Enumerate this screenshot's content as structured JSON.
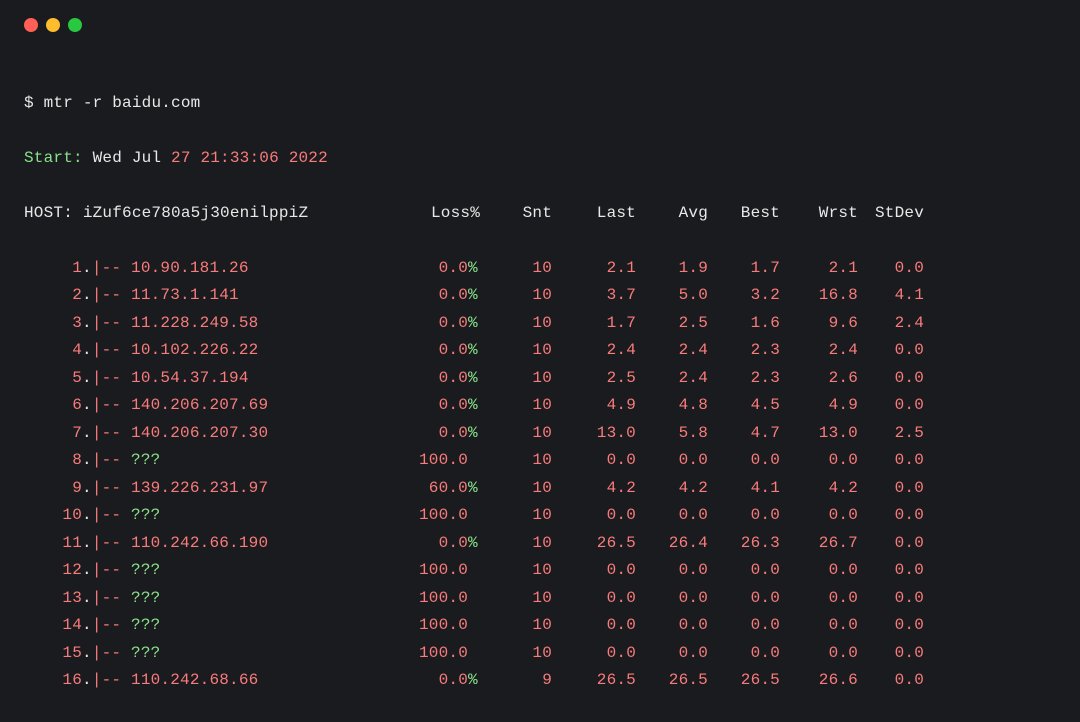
{
  "prompt": "$ ",
  "command": {
    "bin": "mtr",
    "flag": " -r ",
    "target": "baidu.com"
  },
  "start": {
    "label": "Start:",
    "day": " Wed Jul ",
    "date_num": "27",
    "time_sep": " ",
    "time": "21:33:06",
    "year_sep": " ",
    "year": "2022"
  },
  "header": {
    "host_label": "HOST: ",
    "host_value": "iZuf6ce780a5j30enilppiZ",
    "loss": "Loss%",
    "snt": "Snt",
    "last": "Last",
    "avg": "Avg",
    "best": "Best",
    "wrst": "Wrst",
    "stdev": "StDev"
  },
  "hops": [
    {
      "idx": "1",
      "ip": "10.90.181.26",
      "unknown": false,
      "loss": "0.0",
      "pct": "%",
      "snt": "10",
      "last": "2.1",
      "avg": "1.9",
      "best": "1.7",
      "wrst": "2.1",
      "stdev": "0.0"
    },
    {
      "idx": "2",
      "ip": "11.73.1.141",
      "unknown": false,
      "loss": "0.0",
      "pct": "%",
      "snt": "10",
      "last": "3.7",
      "avg": "5.0",
      "best": "3.2",
      "wrst": "16.8",
      "stdev": "4.1"
    },
    {
      "idx": "3",
      "ip": "11.228.249.58",
      "unknown": false,
      "loss": "0.0",
      "pct": "%",
      "snt": "10",
      "last": "1.7",
      "avg": "2.5",
      "best": "1.6",
      "wrst": "9.6",
      "stdev": "2.4"
    },
    {
      "idx": "4",
      "ip": "10.102.226.22",
      "unknown": false,
      "loss": "0.0",
      "pct": "%",
      "snt": "10",
      "last": "2.4",
      "avg": "2.4",
      "best": "2.3",
      "wrst": "2.4",
      "stdev": "0.0"
    },
    {
      "idx": "5",
      "ip": "10.54.37.194",
      "unknown": false,
      "loss": "0.0",
      "pct": "%",
      "snt": "10",
      "last": "2.5",
      "avg": "2.4",
      "best": "2.3",
      "wrst": "2.6",
      "stdev": "0.0"
    },
    {
      "idx": "6",
      "ip": "140.206.207.69",
      "unknown": false,
      "loss": "0.0",
      "pct": "%",
      "snt": "10",
      "last": "4.9",
      "avg": "4.8",
      "best": "4.5",
      "wrst": "4.9",
      "stdev": "0.0"
    },
    {
      "idx": "7",
      "ip": "140.206.207.30",
      "unknown": false,
      "loss": "0.0",
      "pct": "%",
      "snt": "10",
      "last": "13.0",
      "avg": "5.8",
      "best": "4.7",
      "wrst": "13.0",
      "stdev": "2.5"
    },
    {
      "idx": "8",
      "ip": "???",
      "unknown": true,
      "loss": "100.0",
      "pct": "",
      "snt": "10",
      "last": "0.0",
      "avg": "0.0",
      "best": "0.0",
      "wrst": "0.0",
      "stdev": "0.0"
    },
    {
      "idx": "9",
      "ip": "139.226.231.97",
      "unknown": false,
      "loss": "60.0",
      "pct": "%",
      "snt": "10",
      "last": "4.2",
      "avg": "4.2",
      "best": "4.1",
      "wrst": "4.2",
      "stdev": "0.0"
    },
    {
      "idx": "10",
      "ip": "???",
      "unknown": true,
      "loss": "100.0",
      "pct": "",
      "snt": "10",
      "last": "0.0",
      "avg": "0.0",
      "best": "0.0",
      "wrst": "0.0",
      "stdev": "0.0"
    },
    {
      "idx": "11",
      "ip": "110.242.66.190",
      "unknown": false,
      "loss": "0.0",
      "pct": "%",
      "snt": "10",
      "last": "26.5",
      "avg": "26.4",
      "best": "26.3",
      "wrst": "26.7",
      "stdev": "0.0"
    },
    {
      "idx": "12",
      "ip": "???",
      "unknown": true,
      "loss": "100.0",
      "pct": "",
      "snt": "10",
      "last": "0.0",
      "avg": "0.0",
      "best": "0.0",
      "wrst": "0.0",
      "stdev": "0.0"
    },
    {
      "idx": "13",
      "ip": "???",
      "unknown": true,
      "loss": "100.0",
      "pct": "",
      "snt": "10",
      "last": "0.0",
      "avg": "0.0",
      "best": "0.0",
      "wrst": "0.0",
      "stdev": "0.0"
    },
    {
      "idx": "14",
      "ip": "???",
      "unknown": true,
      "loss": "100.0",
      "pct": "",
      "snt": "10",
      "last": "0.0",
      "avg": "0.0",
      "best": "0.0",
      "wrst": "0.0",
      "stdev": "0.0"
    },
    {
      "idx": "15",
      "ip": "???",
      "unknown": true,
      "loss": "100.0",
      "pct": "",
      "snt": "10",
      "last": "0.0",
      "avg": "0.0",
      "best": "0.0",
      "wrst": "0.0",
      "stdev": "0.0"
    },
    {
      "idx": "16",
      "ip": "110.242.68.66",
      "unknown": false,
      "loss": "0.0",
      "pct": "%",
      "snt": "9",
      "last": "26.5",
      "avg": "26.5",
      "best": "26.5",
      "wrst": "26.6",
      "stdev": "0.0"
    }
  ],
  "sep": {
    "dot": ".",
    "pipe": "|-- "
  }
}
